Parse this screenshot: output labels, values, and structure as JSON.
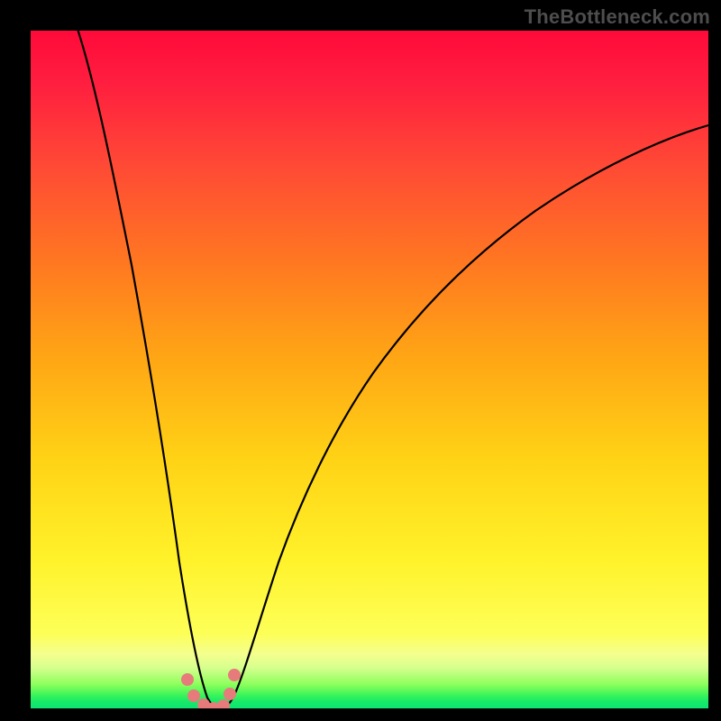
{
  "watermark": "TheBottleneck.com",
  "chart_data": {
    "type": "line",
    "title": "",
    "xlabel": "",
    "ylabel": "",
    "xlim": [
      0,
      100
    ],
    "ylim": [
      0,
      100
    ],
    "curve": {
      "name": "bottleneck-curve",
      "description": "V-shaped curve: steep left arm descending from top-left corner to a minimum near x≈27, then a broad right arm rising toward the upper-right",
      "x": [
        7,
        10,
        13,
        16,
        19,
        21,
        23,
        25,
        26,
        27,
        28,
        29,
        30,
        32,
        35,
        40,
        47,
        55,
        65,
        78,
        92,
        100
      ],
      "y": [
        100,
        87,
        73,
        58,
        42,
        30,
        18,
        7,
        2,
        0,
        0,
        2,
        5,
        11,
        21,
        35,
        49,
        60,
        70,
        78,
        84,
        86
      ]
    },
    "dots": {
      "name": "minimum-dots",
      "color": "#e77b7b",
      "radius_px": 7,
      "x": [
        23.1,
        24.0,
        25.5,
        27.0,
        28.5,
        29.4,
        30.0
      ],
      "y": [
        4.3,
        1.8,
        0.5,
        0,
        0.4,
        2.1,
        5.0
      ]
    },
    "background_gradient": {
      "top": "#ff0a3a",
      "upper_mid": "#ff7a20",
      "mid": "#ffd215",
      "lower": "#fdff58",
      "bottom": "#0be472"
    }
  }
}
